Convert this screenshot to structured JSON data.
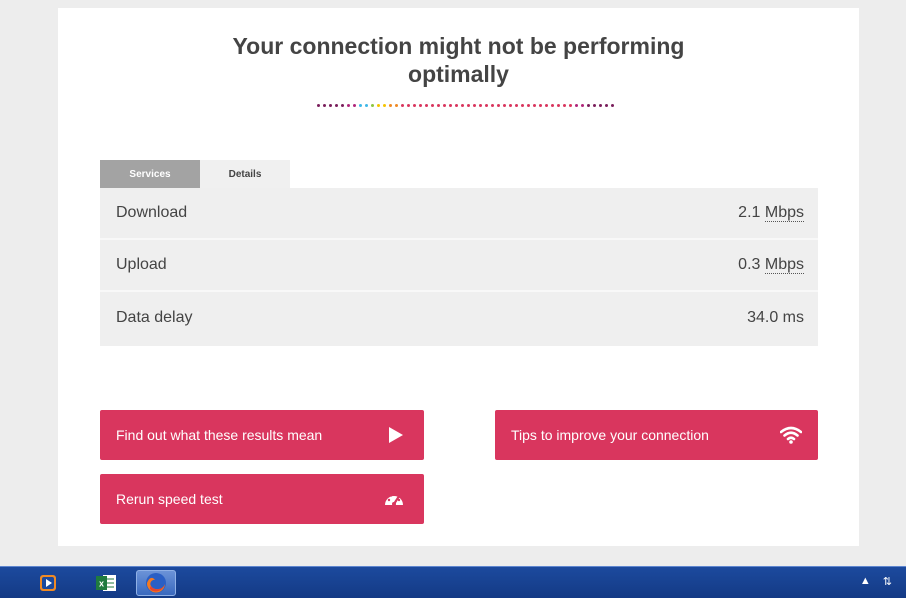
{
  "headline": "Your connection might not be performing optimally",
  "tabs": [
    {
      "label": "Services"
    },
    {
      "label": "Details"
    }
  ],
  "details": [
    {
      "label": "Download",
      "value": "2.1",
      "unit": "Mbps"
    },
    {
      "label": "Upload",
      "value": "0.3",
      "unit": "Mbps"
    },
    {
      "label": "Data delay",
      "value": "34.0",
      "unit": "ms"
    }
  ],
  "buttons": {
    "results": {
      "label": "Find out what these results mean",
      "icon": "play-icon"
    },
    "tips": {
      "label": "Tips to improve your connection",
      "icon": "wifi-icon"
    },
    "rerun": {
      "label": "Rerun speed test",
      "icon": "speedometer-icon"
    }
  },
  "taskbar": {
    "apps": [
      {
        "icon": "media-player-icon"
      },
      {
        "icon": "excel-icon"
      },
      {
        "icon": "firefox-icon"
      }
    ]
  },
  "colors": {
    "accent": "#d9365e",
    "tab_inactive": "#a3a3a3",
    "panel": "#efefef",
    "dots": [
      "#7a1f5c",
      "#b0267a",
      "#3fb8e8",
      "#8dc63f",
      "#f5c400",
      "#f08a24",
      "#d9365e"
    ]
  }
}
